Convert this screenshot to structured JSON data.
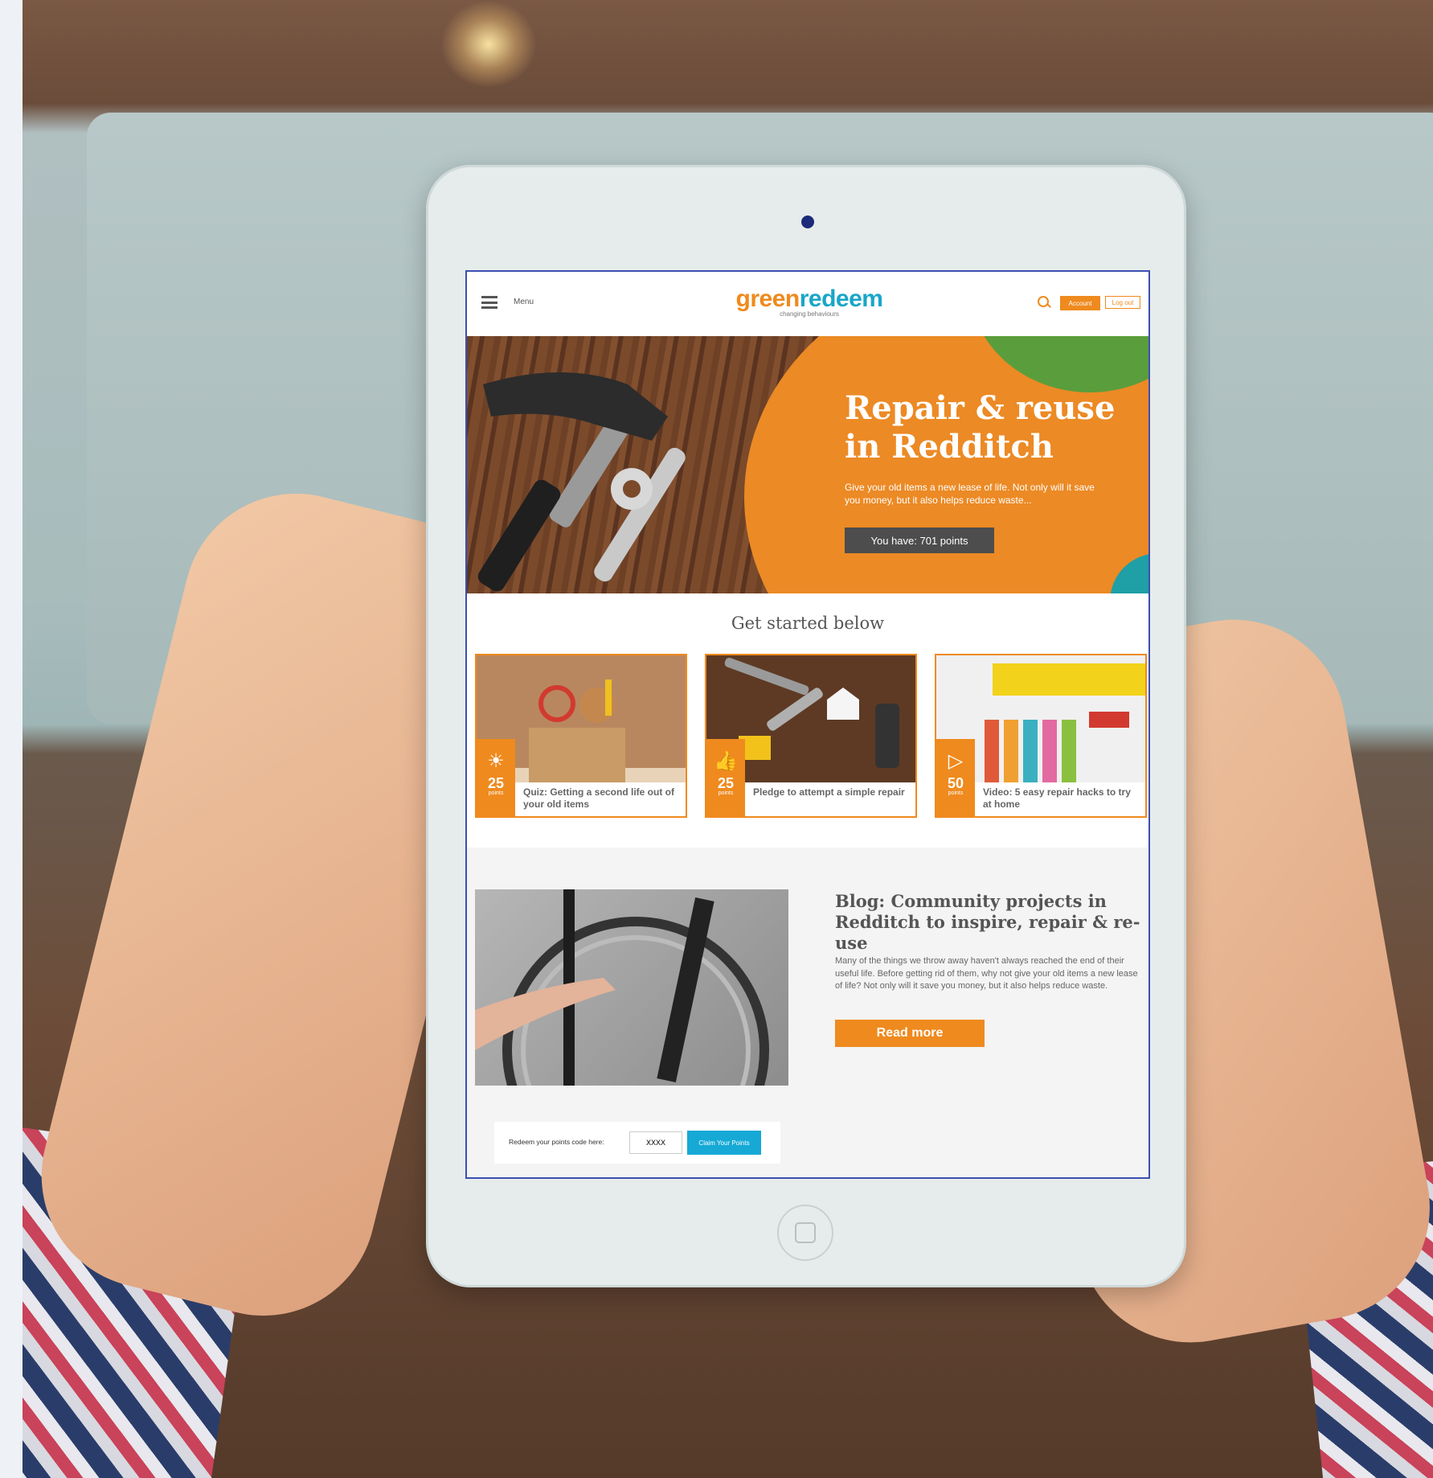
{
  "header": {
    "menu_label": "Menu",
    "logo_part1": "green",
    "logo_part2": "redeem",
    "tagline": "changing behaviours",
    "account_label": "Account",
    "logout_label": "Log out"
  },
  "hero": {
    "title": "Repair & reuse in Redditch",
    "subtitle": "Give your old items a new lease of life. Not only will it save you money, but it also helps reduce waste...",
    "points_button": "You have: 701 points"
  },
  "section_title": "Get started below",
  "cards": [
    {
      "points": "25",
      "unit": "points",
      "label": "Quiz: Getting a second life out of your old items",
      "icon": "lightbulb-icon"
    },
    {
      "points": "25",
      "unit": "points",
      "label": "Pledge to attempt a simple repair",
      "icon": "thumbs-up-icon"
    },
    {
      "points": "50",
      "unit": "points",
      "label": "Video: 5 easy repair hacks to try at home",
      "icon": "play-icon"
    }
  ],
  "blog": {
    "title": "Blog: Community projects in Redditch to inspire, repair & re-use",
    "body": "Many of the things we throw away haven't always reached the end of their useful life. Before getting rid of them, why not give your old items a new lease of life? Not only will it save you money, but it also helps reduce waste.",
    "read_more": "Read more"
  },
  "redeem": {
    "label": "Redeem your points code here:",
    "input_value": "XXXX",
    "button": "Claim Your Points"
  },
  "colors": {
    "brand_orange": "#ef8a1e",
    "brand_blue": "#1aa6c8"
  }
}
